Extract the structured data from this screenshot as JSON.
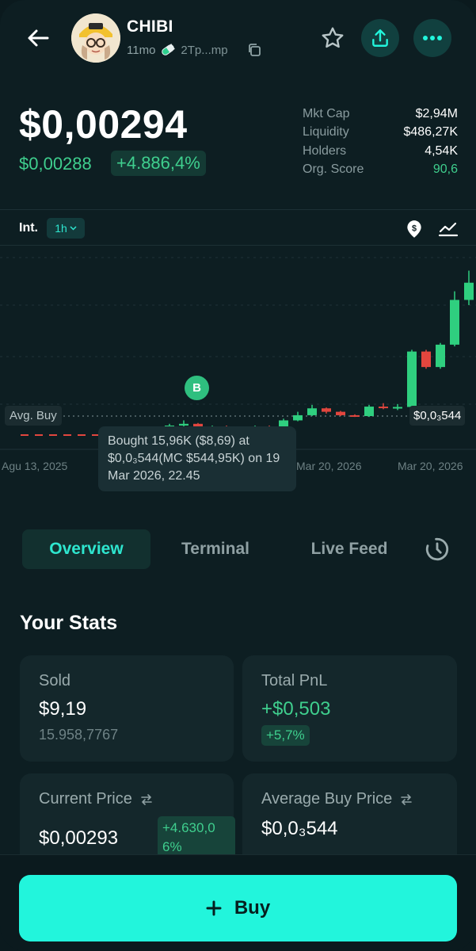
{
  "header": {
    "token_name": "CHIBI",
    "age": "11mo",
    "address": "2Tp...mp"
  },
  "price": {
    "main": "$0,00294",
    "sub": "$0,00288",
    "change": "+4.886,4%"
  },
  "market": [
    {
      "label": "Mkt Cap",
      "value": "$2,94M"
    },
    {
      "label": "Liquidity",
      "value": "$486,27K"
    },
    {
      "label": "Holders",
      "value": "4,54K"
    },
    {
      "label": "Org. Score",
      "value": "90,6"
    }
  ],
  "interval": {
    "label": "Int.",
    "value": "1h"
  },
  "chart": {
    "avg_buy_label": "Avg. Buy",
    "price_tag": "$0,0₃544",
    "marker": "B",
    "x_labels": [
      "Agu 13, 2025",
      "Mar 20, 2026",
      "Mar 20, 2026"
    ],
    "tooltip": "Bought 15,96K ($8,69) at $0,0₃544(MC $544,95K) on 19 Mar 2026, 22.45"
  },
  "chart_data": {
    "type": "candlestick",
    "candles": [
      {
        "o": 0.5,
        "c": 0.52,
        "h": 0.53,
        "l": 0.49,
        "up": true
      },
      {
        "o": 0.52,
        "c": 0.53,
        "h": 0.55,
        "l": 0.51,
        "up": true
      },
      {
        "o": 0.53,
        "c": 0.51,
        "h": 0.535,
        "l": 0.5,
        "up": false
      },
      {
        "o": 0.51,
        "c": 0.515,
        "h": 0.52,
        "l": 0.505,
        "up": true
      },
      {
        "o": 0.515,
        "c": 0.505,
        "h": 0.52,
        "l": 0.5,
        "up": false
      },
      {
        "o": 0.505,
        "c": 0.51,
        "h": 0.515,
        "l": 0.5,
        "up": true
      },
      {
        "o": 0.51,
        "c": 0.515,
        "h": 0.52,
        "l": 0.505,
        "up": true
      },
      {
        "o": 0.515,
        "c": 0.51,
        "h": 0.52,
        "l": 0.505,
        "up": false
      },
      {
        "o": 0.51,
        "c": 0.55,
        "h": 0.56,
        "l": 0.505,
        "up": true
      },
      {
        "o": 0.55,
        "c": 0.58,
        "h": 0.6,
        "l": 0.545,
        "up": true
      },
      {
        "o": 0.58,
        "c": 0.62,
        "h": 0.64,
        "l": 0.575,
        "up": true
      },
      {
        "o": 0.62,
        "c": 0.6,
        "h": 0.625,
        "l": 0.59,
        "up": false
      },
      {
        "o": 0.6,
        "c": 0.58,
        "h": 0.605,
        "l": 0.575,
        "up": false
      },
      {
        "o": 0.58,
        "c": 0.575,
        "h": 0.585,
        "l": 0.57,
        "up": false
      },
      {
        "o": 0.575,
        "c": 0.63,
        "h": 0.64,
        "l": 0.57,
        "up": true
      },
      {
        "o": 0.63,
        "c": 0.625,
        "h": 0.65,
        "l": 0.615,
        "up": false
      },
      {
        "o": 0.625,
        "c": 0.628,
        "h": 0.645,
        "l": 0.61,
        "up": true
      },
      {
        "o": 0.628,
        "c": 0.95,
        "h": 0.96,
        "l": 0.62,
        "up": true
      },
      {
        "o": 0.95,
        "c": 0.86,
        "h": 0.96,
        "l": 0.85,
        "up": false
      },
      {
        "o": 0.86,
        "c": 0.99,
        "h": 1.0,
        "l": 0.85,
        "up": true
      },
      {
        "o": 0.99,
        "c": 1.25,
        "h": 1.3,
        "l": 0.98,
        "up": true
      },
      {
        "o": 1.25,
        "c": 1.35,
        "h": 1.42,
        "l": 1.22,
        "up": true
      }
    ]
  },
  "tabs": [
    {
      "label": "Overview"
    },
    {
      "label": "Terminal"
    },
    {
      "label": "Live Feed"
    }
  ],
  "stats": {
    "title": "Your Stats",
    "sold": {
      "label": "Sold",
      "value": "$9,19",
      "amount": "15.958,7767"
    },
    "pnl": {
      "label": "Total PnL",
      "value": "+$0,503",
      "pct": "+5,7%"
    },
    "current": {
      "label": "Current Price",
      "value": "$0,00293",
      "change": "+4.630,06%"
    },
    "avg": {
      "label": "Average Buy Price",
      "value": "$0,0₃544"
    }
  },
  "buy_button": {
    "label": "Buy"
  },
  "colors": {
    "accent": "#22f5dc",
    "green": "#3fcf8e",
    "red": "#e2463e",
    "background": "#0d1e22"
  }
}
